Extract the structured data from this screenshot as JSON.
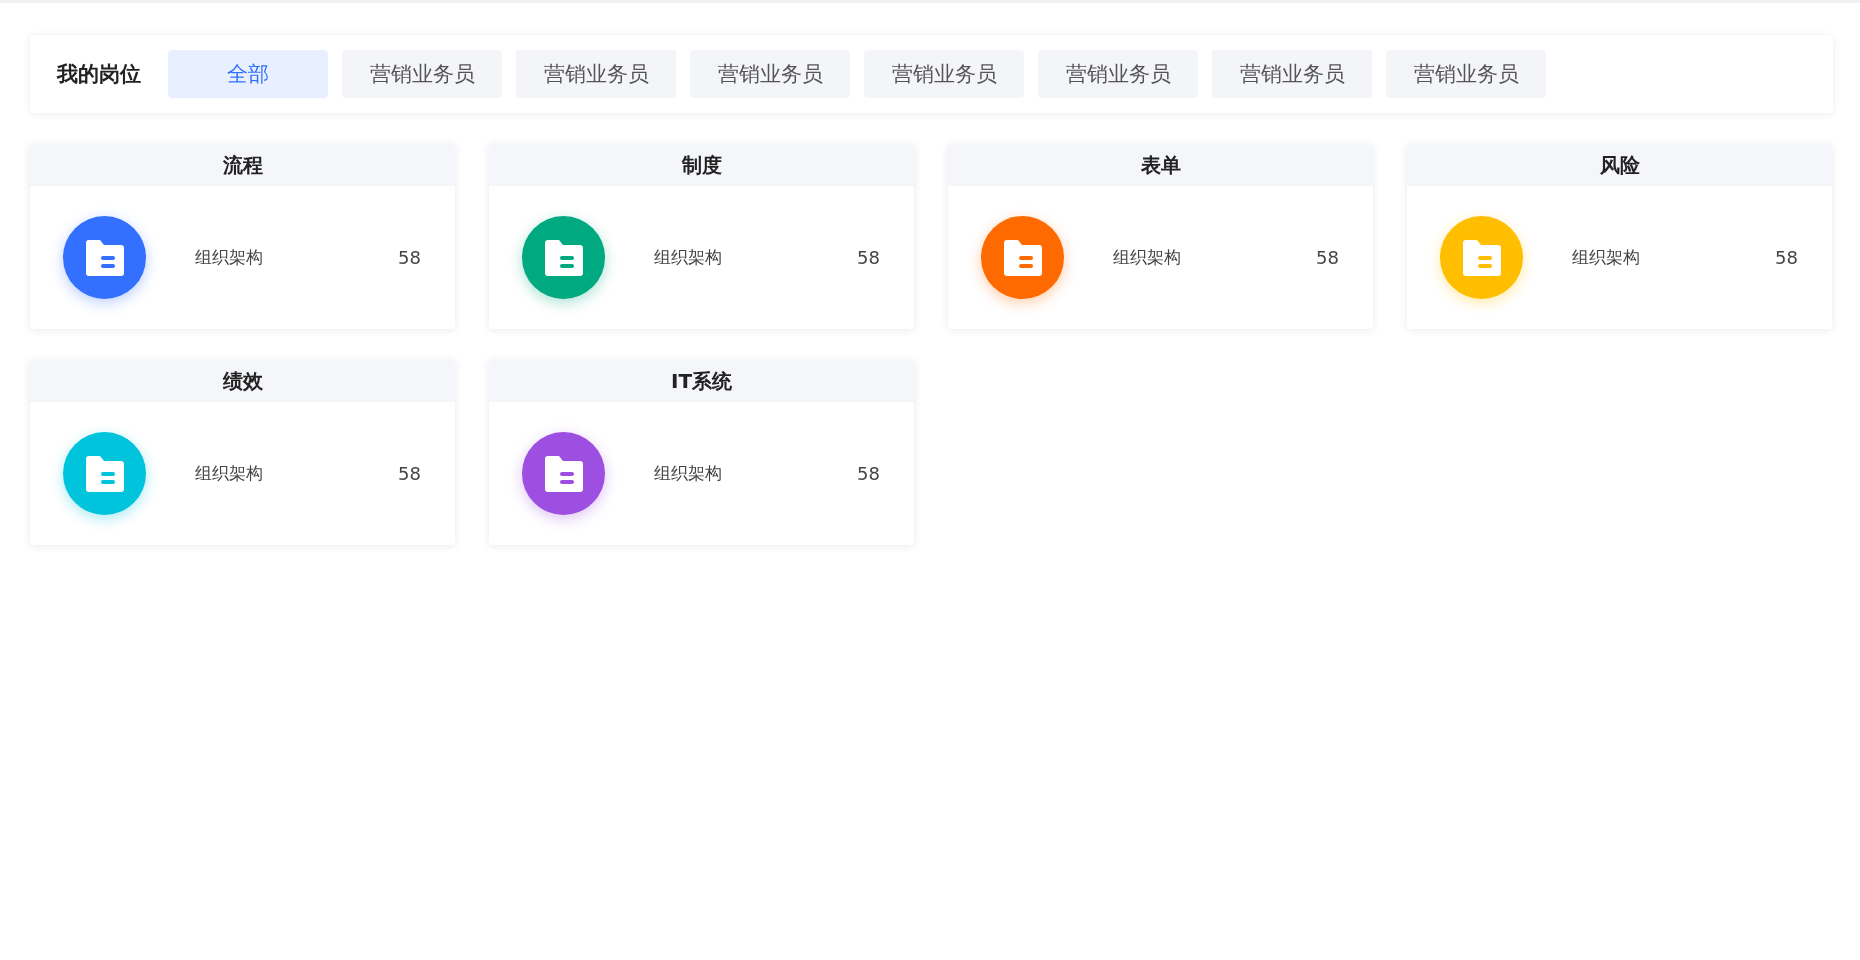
{
  "filter": {
    "label": "我的岗位",
    "tabs": [
      {
        "label": "全部",
        "selected": true
      },
      {
        "label": "营销业务员",
        "selected": false
      },
      {
        "label": "营销业务员",
        "selected": false
      },
      {
        "label": "营销业务员",
        "selected": false
      },
      {
        "label": "营销业务员",
        "selected": false
      },
      {
        "label": "营销业务员",
        "selected": false
      },
      {
        "label": "营销业务员",
        "selected": false
      },
      {
        "label": "营销业务员",
        "selected": false
      }
    ]
  },
  "cards": [
    {
      "title": "流程",
      "color": "#3370ff",
      "item": "组织架构",
      "count": "58"
    },
    {
      "title": "制度",
      "color": "#00a97f",
      "item": "组织架构",
      "count": "58"
    },
    {
      "title": "表单",
      "color": "#ff6a00",
      "item": "组织架构",
      "count": "58"
    },
    {
      "title": "风险",
      "color": "#ffbf00",
      "item": "组织架构",
      "count": "58"
    },
    {
      "title": "绩效",
      "color": "#00c3dc",
      "item": "组织架构",
      "count": "58"
    },
    {
      "title": "IT系统",
      "color": "#9c4fe0",
      "item": "组织架构",
      "count": "58"
    }
  ]
}
